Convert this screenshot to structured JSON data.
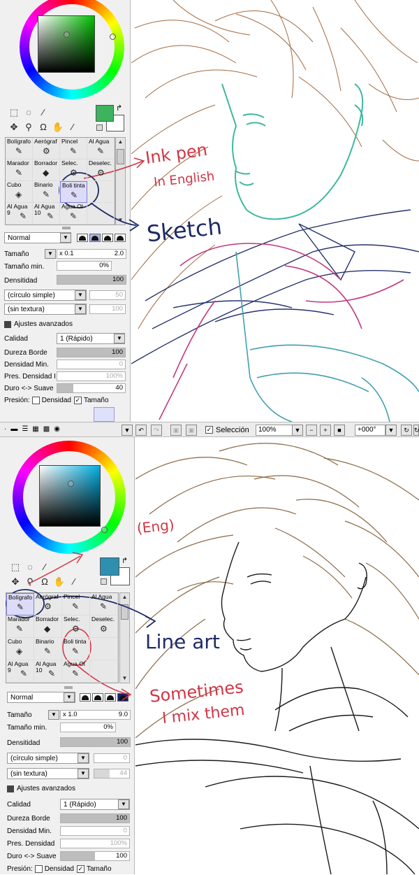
{
  "top": {
    "shape_label": "Normal",
    "size_label": "Tamaño",
    "size_mult": "x 0.1",
    "size_value": "2.0",
    "min_size_label": "Tamaño min.",
    "min_size_value": "0%",
    "density_label": "Densitidad",
    "density_value": "100",
    "shape_select": "(círculo simple)",
    "shape_value": "50",
    "texture_select": "(sin textura)",
    "texture_value": "100",
    "advanced_label": "Ajustes avanzados",
    "quality_label": "Calidad",
    "quality_value": "1 (Rápido)",
    "hardness_label": "Dureza Borde",
    "hardness_value": "100",
    "min_density_label": "Densidad Min.",
    "min_density_value": "0",
    "pres_density_label": "Pres. Densidad I",
    "pres_density_value": "100%",
    "smooth_label": "Duro <-> Suave",
    "smooth_value": "40",
    "pressure_label": "Presión:",
    "pressure_density": "Densidad",
    "pressure_size": "Tamaño",
    "brushes": [
      {
        "label": "Bolígrafo",
        "icon": "pen-icon",
        "glyph": "✎"
      },
      {
        "label": "Aerógraf",
        "icon": "airbrush-icon",
        "glyph": "⚙"
      },
      {
        "label": "Pincel",
        "icon": "brush-icon",
        "glyph": "✎"
      },
      {
        "label": "Al Agua",
        "icon": "watercolor-icon",
        "glyph": "✎"
      },
      {
        "label": "Marador",
        "icon": "marker-icon",
        "glyph": "✎"
      },
      {
        "label": "Borrador",
        "icon": "eraser-icon",
        "glyph": "◆"
      },
      {
        "label": "Selec.",
        "icon": "select-brush-icon",
        "glyph": "⚙"
      },
      {
        "label": "Deselec.",
        "icon": "deselect-brush-icon",
        "glyph": "⚙"
      },
      {
        "label": "Cubo",
        "icon": "bucket-icon",
        "glyph": "◈"
      },
      {
        "label": "Binario",
        "icon": "binary-icon",
        "glyph": "✎"
      },
      {
        "label": "Boli tinta",
        "icon": "ink-pen-icon",
        "glyph": "✎"
      },
      {
        "label": "",
        "icon": "",
        "glyph": ""
      },
      {
        "label": "Al Agua 9",
        "icon": "watercolor-icon",
        "glyph": "✎"
      },
      {
        "label": "Al Agua 10",
        "icon": "watercolor-icon",
        "glyph": "✎"
      },
      {
        "label": "Agua Ol",
        "icon": "water-oil-icon",
        "glyph": "✎"
      },
      {
        "label": "",
        "icon": "",
        "glyph": ""
      }
    ]
  },
  "toolbar": {
    "selection_label": "Selección",
    "zoom": "100%",
    "rotation": "+000°"
  },
  "bottom": {
    "shape_label": "Normal",
    "size_label": "Tamaño",
    "size_mult": "x 1.0",
    "size_value": "9.0",
    "min_size_label": "Tamaño min.",
    "min_size_value": "0%",
    "density_label": "Densitidad",
    "density_value": "100",
    "shape_select": "(círculo simple)",
    "shape_value": "0",
    "texture_select": "(sin textura)",
    "texture_value": "44",
    "advanced_label": "Ajustes avanzados",
    "quality_label": "Calidad",
    "quality_value": "1 (Rápido)",
    "hardness_label": "Dureza Borde",
    "hardness_value": "100",
    "min_density_label": "Densidad Min.",
    "min_density_value": "0",
    "pres_density_label": "Pres. Densidad",
    "pres_density_value": "100%",
    "smooth_label": "Duro <-> Suave",
    "smooth_value": "100",
    "pressure_label": "Presión:",
    "pressure_density": "Densidad",
    "pressure_size": "Tamaño",
    "brushes": [
      {
        "label": "Bolígrafo",
        "icon": "pen-icon",
        "glyph": "✎"
      },
      {
        "label": "Aerógraf",
        "icon": "airbrush-icon",
        "glyph": "⚙"
      },
      {
        "label": "Pincel",
        "icon": "brush-icon",
        "glyph": "✎"
      },
      {
        "label": "Al Agua",
        "icon": "watercolor-icon",
        "glyph": "✎"
      },
      {
        "label": "Marador",
        "icon": "marker-icon",
        "glyph": "✎"
      },
      {
        "label": "Borrador",
        "icon": "eraser-icon",
        "glyph": "◆"
      },
      {
        "label": "Selec.",
        "icon": "select-brush-icon",
        "glyph": "⚙"
      },
      {
        "label": "Deselec.",
        "icon": "deselect-brush-icon",
        "glyph": "⚙"
      },
      {
        "label": "Cubo",
        "icon": "bucket-icon",
        "glyph": "◈"
      },
      {
        "label": "Binario",
        "icon": "binary-icon",
        "glyph": "✎"
      },
      {
        "label": "Boli tinta",
        "icon": "ink-pen-icon",
        "glyph": "✎"
      },
      {
        "label": "",
        "icon": "",
        "glyph": ""
      },
      {
        "label": "Al Agua 9",
        "icon": "watercolor-icon",
        "glyph": "✎"
      },
      {
        "label": "Al Agua 10",
        "icon": "watercolor-icon",
        "glyph": "✎"
      },
      {
        "label": "Agua Ol",
        "icon": "water-oil-icon",
        "glyph": "✎"
      },
      {
        "label": "",
        "icon": "",
        "glyph": ""
      }
    ]
  },
  "annotations": {
    "ink_pen": "Ink pen",
    "in_english": "In English",
    "sketch": "Sketch",
    "pen_eng": "pen (Eng)",
    "lineart": "Line art",
    "sometimes": "Sometimes",
    "i_mix_them": "I mix them"
  },
  "colors": {
    "top_primary": "#3cb35c",
    "bottom_primary": "#2f8fb0",
    "annotation_red": "#d03545",
    "annotation_navy": "#1f2b66",
    "sketch_teal": "#3fb8a0",
    "sketch_magenta": "#c23880",
    "sketch_navy": "#27336e",
    "sketch_brown": "#a36a40",
    "lineart_brown": "#8a6a46",
    "lineart_black": "#1a1a1a"
  }
}
